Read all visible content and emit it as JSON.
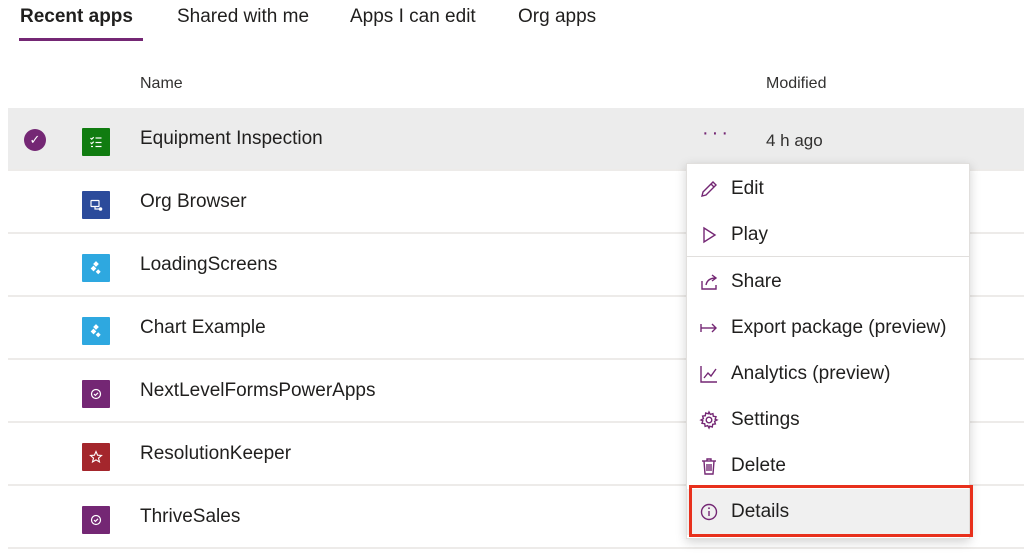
{
  "tabs": [
    {
      "label": "Recent apps",
      "active": true
    },
    {
      "label": "Shared with me",
      "active": false
    },
    {
      "label": "Apps I can edit",
      "active": false
    },
    {
      "label": "Org apps",
      "active": false
    }
  ],
  "columns": {
    "name": "Name",
    "modified": "Modified"
  },
  "rows": [
    {
      "name": "Equipment Inspection",
      "icon": "checklist-icon",
      "icon_color": "#107c10",
      "modified": "4 h ago",
      "selected": true
    },
    {
      "name": "Org Browser",
      "icon": "org-browser-icon",
      "icon_color": "#2b4b9b",
      "selected": false
    },
    {
      "name": "LoadingScreens",
      "icon": "canvas-app-icon",
      "icon_color": "#2ea8e0",
      "selected": false
    },
    {
      "name": "Chart Example",
      "icon": "canvas-app-icon",
      "icon_color": "#2ea8e0",
      "selected": false
    },
    {
      "name": "NextLevelFormsPowerApps",
      "icon": "check-badge-icon",
      "icon_color": "#742774",
      "selected": false
    },
    {
      "name": "ResolutionKeeper",
      "icon": "star-icon",
      "icon_color": "#a4262c",
      "selected": false
    },
    {
      "name": "ThriveSales",
      "icon": "check-badge-icon",
      "icon_color": "#742774",
      "selected": false
    }
  ],
  "menu": {
    "items": [
      {
        "label": "Edit",
        "icon": "pencil-icon"
      },
      {
        "label": "Play",
        "icon": "play-icon"
      },
      {
        "label": "Share",
        "icon": "share-icon"
      },
      {
        "label": "Export package (preview)",
        "icon": "export-icon"
      },
      {
        "label": "Analytics (preview)",
        "icon": "analytics-icon"
      },
      {
        "label": "Settings",
        "icon": "gear-icon"
      },
      {
        "label": "Delete",
        "icon": "trash-icon"
      },
      {
        "label": "Details",
        "icon": "info-icon"
      }
    ]
  },
  "colors": {
    "accent": "#742774",
    "highlight": "#e8301c"
  }
}
